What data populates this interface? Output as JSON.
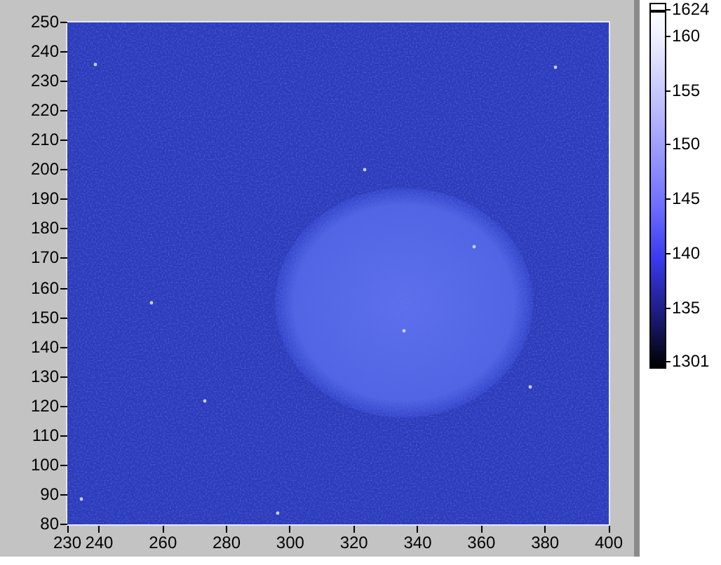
{
  "y_axis": {
    "ticks": [
      "250",
      "240",
      "230",
      "220",
      "210",
      "200",
      "190",
      "180",
      "170",
      "160",
      "150",
      "140",
      "130",
      "120",
      "110",
      "100",
      "90",
      "80"
    ]
  },
  "x_axis": {
    "ticks": [
      "230",
      "240",
      "260",
      "280",
      "300",
      "320",
      "340",
      "360",
      "380",
      "400"
    ]
  },
  "color_scale": {
    "labels": [
      "1624",
      "160",
      "155",
      "150",
      "145",
      "140",
      "135",
      "1301"
    ]
  }
}
